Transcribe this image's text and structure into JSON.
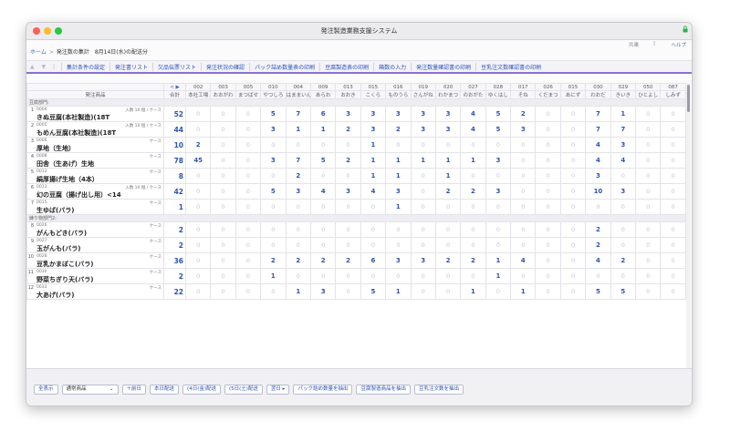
{
  "window": {
    "title": "発注製造業務支援システム"
  },
  "user": {
    "name": "共乗",
    "sep": "|",
    "help": "ヘルプ"
  },
  "breadcrumb": {
    "home": "ホーム",
    "arrow": ">",
    "current": "発注数の集計　8月14日(水)の配送分"
  },
  "nav_arrows": "▲ ▼ |",
  "tabs": [
    "集計条件の設定",
    "発注書リスト",
    "欠品伝票リスト",
    "発注状況の確認",
    "パック詰め数量表の印刷",
    "豆腐製造表の印刷",
    "箱数の入力",
    "発注数量確認書の印刷",
    "豆乳注文数確認書の印刷"
  ],
  "table": {
    "pager": "< ▶",
    "header_product": "発注商品",
    "header_total": "合計",
    "shops": [
      {
        "code": "002",
        "name": "本社工場"
      },
      {
        "code": "003",
        "name": "おおがわ"
      },
      {
        "code": "005",
        "name": "まつばせ"
      },
      {
        "code": "010",
        "name": "やつしろ"
      },
      {
        "code": "004",
        "name": "はままいん"
      },
      {
        "code": "009",
        "name": "あらお"
      },
      {
        "code": "013",
        "name": "おおき"
      },
      {
        "code": "015",
        "name": "こくら"
      },
      {
        "code": "016",
        "name": "ものうら"
      },
      {
        "code": "019",
        "name": "さんがね"
      },
      {
        "code": "020",
        "name": "わかまつ"
      },
      {
        "code": "027",
        "name": "のおがた"
      },
      {
        "code": "028",
        "name": "ゆくはし"
      },
      {
        "code": "017",
        "name": "そね"
      },
      {
        "code": "026",
        "name": "くだまつ"
      },
      {
        "code": "015",
        "name": "あにず"
      },
      {
        "code": "030",
        "name": "わおだ"
      },
      {
        "code": "029",
        "name": "きいき"
      },
      {
        "code": "050",
        "name": "ひとよし"
      },
      {
        "code": "087",
        "name": "しみず"
      }
    ],
    "sections": [
      {
        "label": "豆腐部門:",
        "rows": [
          {
            "idx": "1",
            "code": "0004",
            "unit": "入数 10 個 / ケース",
            "name": "きぬ豆腐(本社製造)(18T",
            "total": "52",
            "qty": [
              "0",
              "0",
              "0",
              "5",
              "7",
              "6",
              "3",
              "3",
              "3",
              "3",
              "3",
              "4",
              "5",
              "2",
              "0",
              "0",
              "7",
              "1",
              "0",
              "0"
            ]
          },
          {
            "idx": "2",
            "code": "0005",
            "unit": "入数 10 個 / ケース",
            "name": "もめん豆腐(本社製造)(18T",
            "total": "44",
            "qty": [
              "0",
              "0",
              "0",
              "3",
              "1",
              "1",
              "2",
              "3",
              "2",
              "3",
              "3",
              "4",
              "5",
              "3",
              "0",
              "0",
              "7",
              "7",
              "0",
              "0"
            ]
          },
          {
            "idx": "3",
            "code": "0006",
            "unit": "ケース",
            "name": "厚地（生地）",
            "total": "10",
            "qty": [
              "2",
              "0",
              "0",
              "0",
              "0",
              "0",
              "0",
              "1",
              "0",
              "0",
              "0",
              "0",
              "0",
              "0",
              "0",
              "0",
              "4",
              "3",
              "0",
              "0"
            ]
          },
          {
            "idx": "4",
            "code": "0008",
            "unit": "ケース",
            "name": "田舎（生あげ）生地",
            "total": "78",
            "qty": [
              "45",
              "0",
              "0",
              "3",
              "7",
              "5",
              "2",
              "1",
              "1",
              "1",
              "1",
              "1",
              "3",
              "0",
              "0",
              "0",
              "4",
              "4",
              "0",
              "0"
            ]
          },
          {
            "idx": "5",
            "code": "0012",
            "unit": "ケース",
            "name": "絹厚揚げ生地（4本）",
            "total": "8",
            "qty": [
              "0",
              "0",
              "0",
              "0",
              "2",
              "0",
              "0",
              "1",
              "1",
              "0",
              "1",
              "0",
              "0",
              "0",
              "0",
              "0",
              "3",
              "0",
              "0",
              "0"
            ]
          },
          {
            "idx": "6",
            "code": "0013",
            "unit": "入数 10 個 / ケース",
            "name": "幻の豆腐（揚げ出し用）<14",
            "total": "42",
            "qty": [
              "0",
              "0",
              "0",
              "5",
              "3",
              "4",
              "3",
              "4",
              "3",
              "0",
              "2",
              "2",
              "3",
              "0",
              "0",
              "0",
              "10",
              "3",
              "0",
              "0"
            ]
          },
          {
            "idx": "7",
            "code": "0015",
            "unit": "ケース",
            "name": "生ゆば(バラ)",
            "total": "1",
            "qty": [
              "0",
              "0",
              "0",
              "0",
              "0",
              "0",
              "0",
              "0",
              "1",
              "0",
              "0",
              "0",
              "0",
              "0",
              "0",
              "0",
              "0",
              "0",
              "0",
              "0"
            ]
          }
        ]
      },
      {
        "label": "練り物部門2:",
        "rows": [
          {
            "idx": "8",
            "code": "0026",
            "unit": "ケース",
            "name": "がんもどき(バラ)",
            "total": "2",
            "qty": [
              "0",
              "0",
              "0",
              "0",
              "0",
              "0",
              "0",
              "0",
              "0",
              "0",
              "0",
              "0",
              "0",
              "0",
              "0",
              "0",
              "2",
              "0",
              "0",
              "0"
            ]
          },
          {
            "idx": "9",
            "code": "0027",
            "unit": "ケース",
            "name": "玉がんも(バラ)",
            "total": "2",
            "qty": [
              "0",
              "0",
              "0",
              "0",
              "0",
              "0",
              "0",
              "0",
              "0",
              "0",
              "0",
              "0",
              "0",
              "0",
              "0",
              "0",
              "2",
              "0",
              "0",
              "0"
            ]
          },
          {
            "idx": "10",
            "code": "0028",
            "unit": "ケース",
            "name": "豆乳かまぼこ(バラ)",
            "total": "36",
            "qty": [
              "0",
              "0",
              "0",
              "2",
              "2",
              "2",
              "2",
              "6",
              "3",
              "3",
              "2",
              "2",
              "1",
              "4",
              "0",
              "0",
              "4",
              "2",
              "0",
              "0"
            ]
          },
          {
            "idx": "11",
            "code": "0030",
            "unit": "ケース",
            "name": "野菜ちぎり天(バラ)",
            "total": "2",
            "qty": [
              "0",
              "0",
              "0",
              "1",
              "0",
              "0",
              "0",
              "0",
              "0",
              "0",
              "0",
              "0",
              "1",
              "0",
              "0",
              "0",
              "0",
              "0",
              "0",
              "0"
            ]
          },
          {
            "idx": "12",
            "code": "0033",
            "unit": "ケース",
            "name": "大あげ(バラ)",
            "total": "22",
            "qty": [
              "0",
              "0",
              "0",
              "0",
              "1",
              "3",
              "0",
              "5",
              "1",
              "0",
              "0",
              "1",
              "0",
              "1",
              "0",
              "0",
              "5",
              "5",
              "0",
              "0"
            ]
          }
        ]
      }
    ]
  },
  "footer": {
    "buttons": [
      "全表示",
      "通常商品",
      "＋前日",
      "本日配送",
      "(4日(金)配送",
      "(5日(土)配送",
      "翌日 ▸",
      "パック詰め数量を抽出",
      "豆腐製造商品を抽出",
      "豆乳注文数を抽出"
    ],
    "select_arrow": "⌄"
  }
}
